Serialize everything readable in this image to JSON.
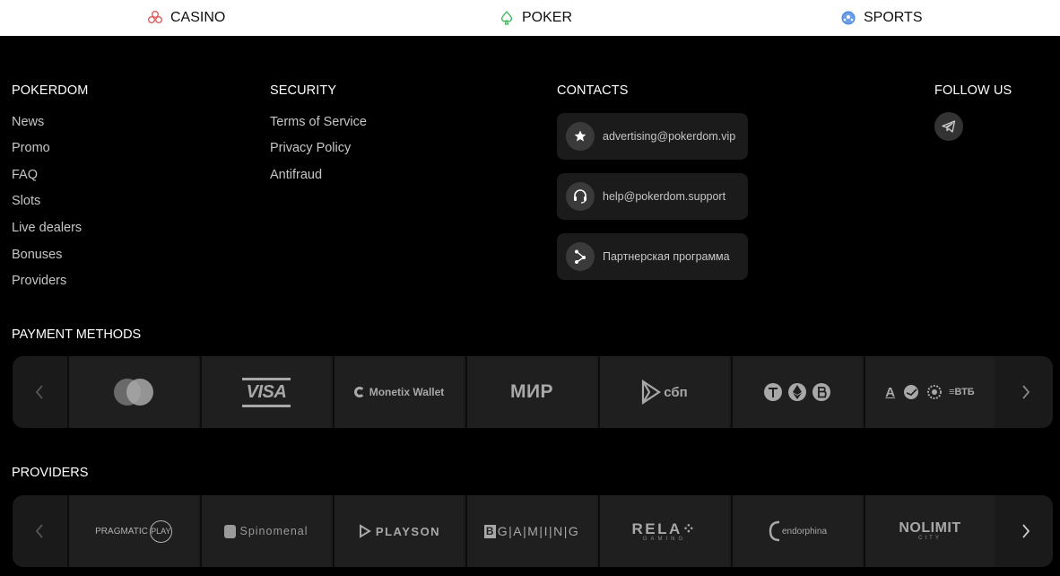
{
  "nav": {
    "casino": "CASINO",
    "poker": "POKER",
    "sports": "SPORTS"
  },
  "columns": {
    "pokerdom": {
      "title": "POKERDOM",
      "links": [
        "News",
        "Promo",
        "FAQ",
        "Slots",
        "Live dealers",
        "Bonuses",
        "Providers"
      ]
    },
    "security": {
      "title": "SECURITY",
      "links": [
        "Terms of Service",
        "Privacy Policy",
        "Antifraud"
      ]
    },
    "contacts": {
      "title": "CONTACTS",
      "items": [
        {
          "icon": "star-icon",
          "text": "advertising@pokerdom.vip"
        },
        {
          "icon": "headset-icon",
          "text": "help@pokerdom.support"
        },
        {
          "icon": "share-icon",
          "text": "Партнерская программа"
        }
      ]
    },
    "follow": {
      "title": "FOLLOW US",
      "icons": [
        "telegram-icon"
      ]
    }
  },
  "payments": {
    "title": "PAYMENT METHODS",
    "logos": {
      "visa": "VISA",
      "monetix": "Monetix Wallet",
      "mir": "МИР",
      "sbp": "сбп",
      "vtb": "ВТБ",
      "alfa": "А"
    },
    "tiles": [
      "mastercard-logo",
      "visa-logo",
      "monetix-wallet-logo",
      "mir-logo",
      "sbp-logo",
      "crypto-logos",
      "banks-logos"
    ]
  },
  "providers": {
    "title": "PROVIDERS",
    "logos": {
      "pragmatic": "PRAGMATIC",
      "pragmatic_play": "PLAY",
      "spinomenal": "Spinomenal",
      "playson": "PLAYSON",
      "bgaming": "G|A|M|I|N|G",
      "relax": "RELA",
      "relax_sub": "GAMING",
      "endorphina": "endorphina",
      "nolimit": "NOLIMIT",
      "nolimit_sub": "CITY"
    },
    "tiles": [
      "pragmatic-play-logo",
      "spinomenal-logo",
      "playson-logo",
      "bgaming-logo",
      "relax-gaming-logo",
      "endorphina-logo",
      "nolimit-city-logo"
    ]
  },
  "colors": {
    "background": "#000000",
    "card": "#1b1b1b",
    "link": "#c6c6c6",
    "casino_accent": "#e25b5b",
    "poker_accent": "#3bb85a",
    "sports_accent": "#3f7fd8"
  }
}
